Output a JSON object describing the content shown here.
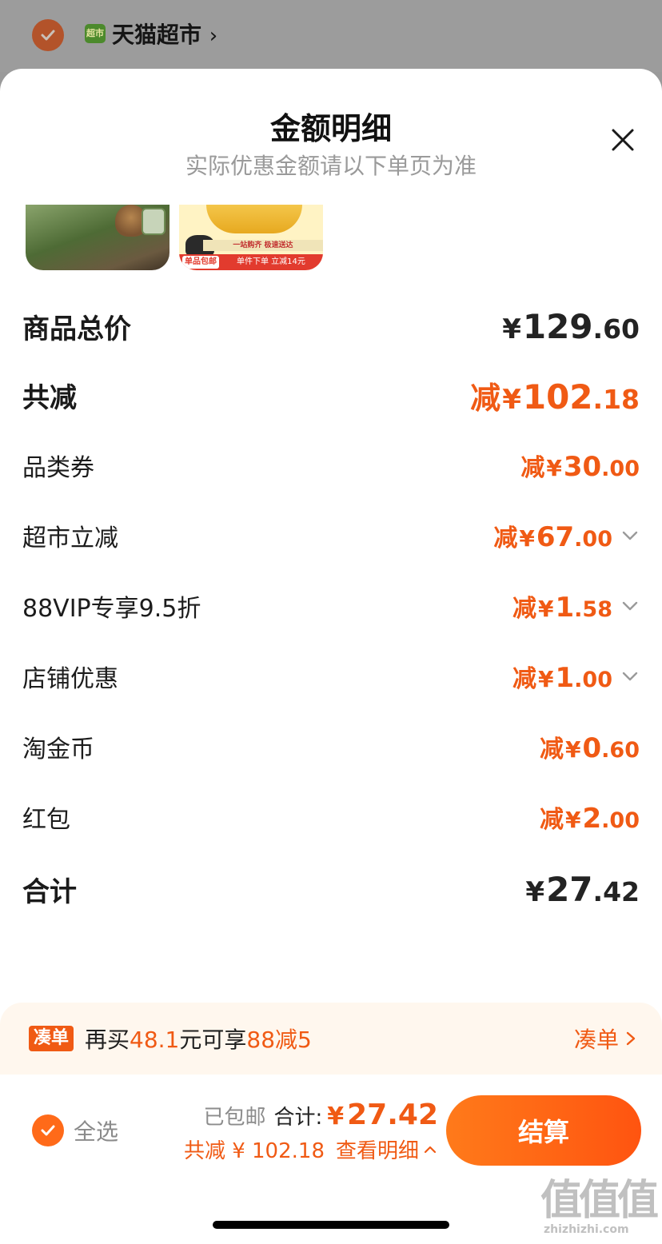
{
  "background": {
    "store_logo_text": "超市",
    "store_name": "天猫超市"
  },
  "sheet": {
    "title": "金额明细",
    "subtitle": "实际优惠金额请以下单页为准"
  },
  "thumbnails": {
    "promo_line": "一站购齐 极速送达",
    "promo_bottom": "单件下单 立减14元",
    "promo_tag": "单品包邮"
  },
  "rows": [
    {
      "label": "商品总价",
      "prefix": "",
      "int": "129",
      "dec": ".60",
      "style": "dark-big",
      "expandable": false
    },
    {
      "label": "共减",
      "prefix": "减",
      "int": "102",
      "dec": ".18",
      "style": "orange-big",
      "expandable": false
    },
    {
      "label": "品类券",
      "prefix": "减",
      "int": "30",
      "dec": ".00",
      "style": "orange",
      "expandable": false
    },
    {
      "label": "超市立减",
      "prefix": "减",
      "int": "67",
      "dec": ".00",
      "style": "orange",
      "expandable": true
    },
    {
      "label": "88VIP专享9.5折",
      "prefix": "减",
      "int": "1",
      "dec": ".58",
      "style": "orange",
      "expandable": true
    },
    {
      "label": "店铺优惠",
      "prefix": "减",
      "int": "1",
      "dec": ".00",
      "style": "orange",
      "expandable": true
    },
    {
      "label": "淘金币",
      "prefix": "减",
      "int": "0",
      "dec": ".60",
      "style": "orange",
      "expandable": false
    },
    {
      "label": "红包",
      "prefix": "减",
      "int": "2",
      "dec": ".00",
      "style": "orange",
      "expandable": false
    },
    {
      "label": "合计",
      "prefix": "",
      "int": "27",
      "dec": ".42",
      "style": "dark-big",
      "expandable": false
    }
  ],
  "currency": "¥",
  "coudan": {
    "tag": "凑单",
    "text_before": "再买",
    "amount": "48.1",
    "text_mid": "元可享",
    "offer": "88减5",
    "link": "凑单"
  },
  "bottom_bar": {
    "select_all": "全选",
    "shipping": "已包邮",
    "total_label": "合计:",
    "total_value": "27.42",
    "discount_text": "共减 ¥ 102.18",
    "detail_link": "查看明细",
    "checkout": "结算"
  },
  "watermark": {
    "main": "值值值",
    "sub": "zhizhizhi.com"
  },
  "colors": {
    "accent": "#f05a14",
    "checkout_gradient_start": "#ff7a1a",
    "checkout_gradient_end": "#ff5410"
  }
}
